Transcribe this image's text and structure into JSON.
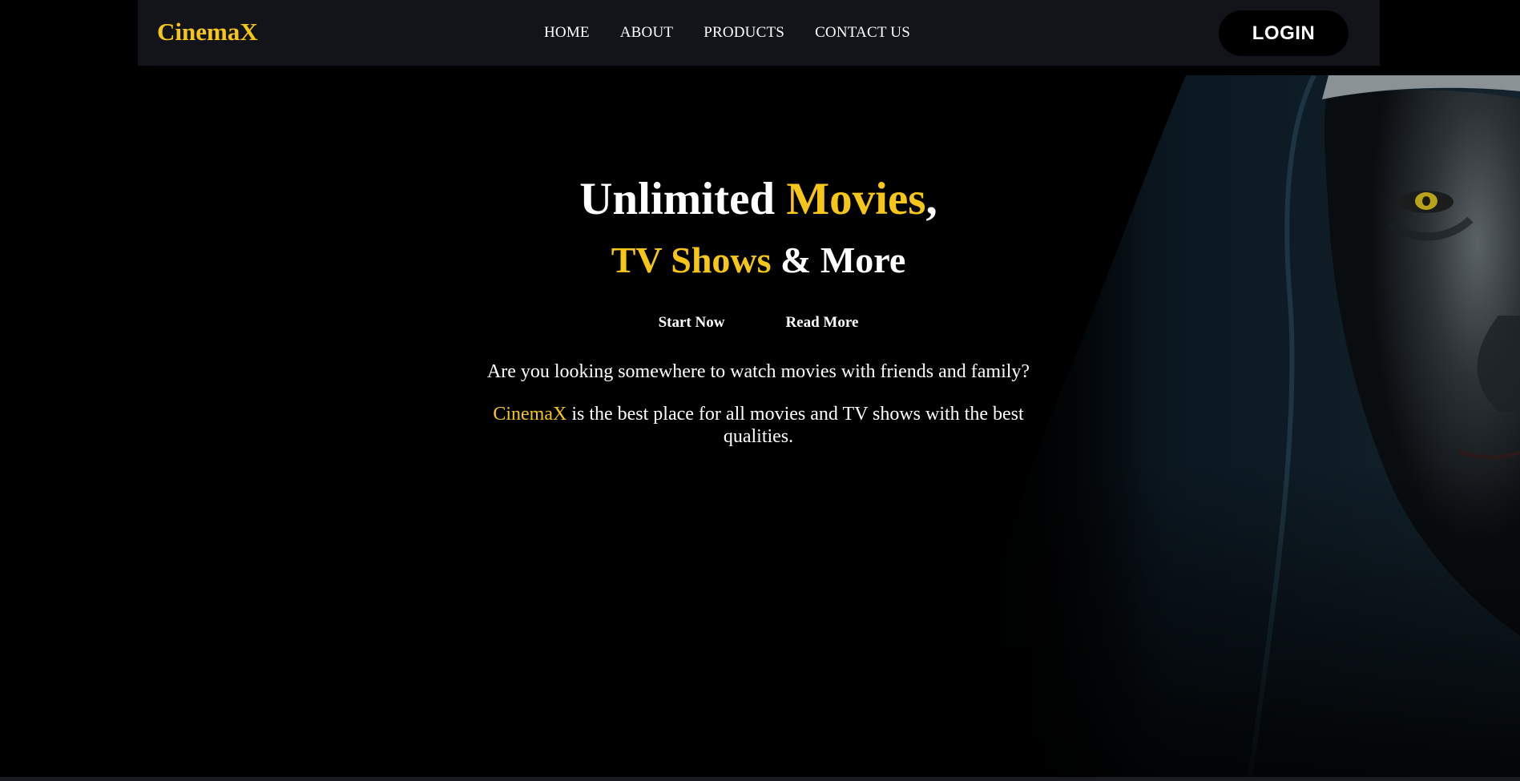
{
  "brand": {
    "name": "CinemaX",
    "accent_color": "#f5c518"
  },
  "nav": {
    "links": [
      "HOME",
      "ABOUT",
      "PRODUCTS",
      "CONTACT US"
    ],
    "login_label": "LOGIN"
  },
  "hero": {
    "headline_line1_part1": "Unlimited ",
    "headline_line1_accent": "Movies",
    "headline_line1_part2": ",",
    "headline_line2_accent": "TV Shows",
    "headline_line2_part2": " & More",
    "cta_primary": "Start Now",
    "cta_secondary": "Read More",
    "description_1": "Are you looking somewhere to watch movies with friends and family?",
    "description_2_brand": "CinemaX",
    "description_2_text": " is the best place for all movies and TV shows with the best qualities.",
    "background_image": "nun-portrait"
  }
}
